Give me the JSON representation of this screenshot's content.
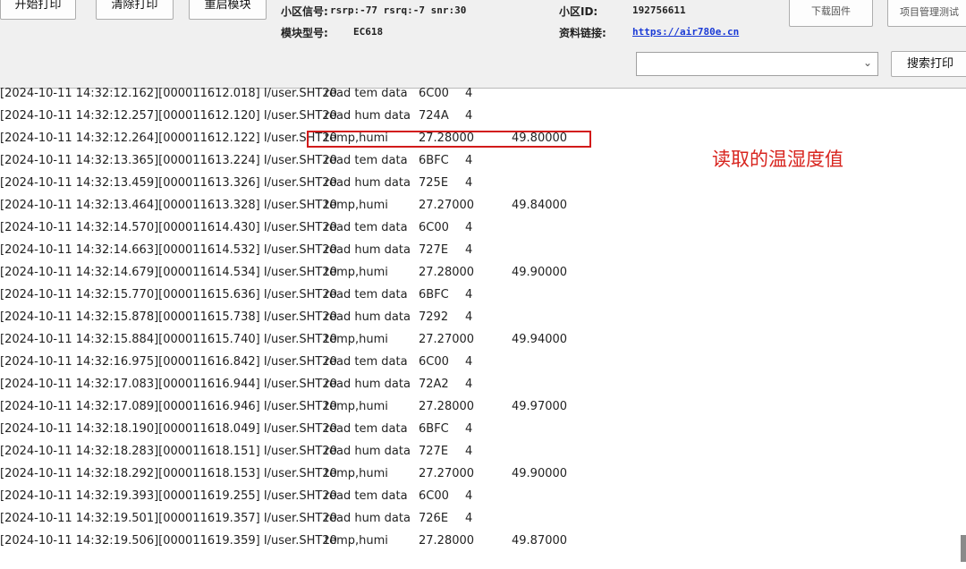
{
  "toolbar": {
    "btn_start_print": "开始打印",
    "btn_clear_print": "清除打印",
    "btn_restart_module": "重启模块",
    "cell_signal_label": "小区信号:",
    "cell_signal_value": "rsrp:-77 rsrq:-7 snr:30",
    "module_model_label": "模块型号:",
    "module_model_value": "EC618",
    "cell_id_label": "小区ID:",
    "cell_id_value": "192756611",
    "resource_link_label": "资料链接:",
    "resource_link_value": "https://air780e.cn",
    "btn_download_firmware": "下载固件",
    "btn_project_test": "项目管理测试",
    "search_combo_value": "",
    "btn_search_print": "搜索打印"
  },
  "annotation": "读取的温湿度值",
  "log_rows": [
    {
      "ts": "[2024-10-11 14:32:12.162][000011612.018] I/user.SHT20",
      "msg": "read tem data",
      "v1": "6C00",
      "v2": "4",
      "v3": ""
    },
    {
      "ts": "[2024-10-11 14:32:12.257][000011612.120] I/user.SHT20",
      "msg": "read hum data",
      "v1": "724A",
      "v2": "4",
      "v3": ""
    },
    {
      "ts": "[2024-10-11 14:32:12.264][000011612.122] I/user.SHT20",
      "msg": "temp,humi",
      "v1": "27.28000",
      "v2": "",
      "v3": "49.80000"
    },
    {
      "ts": "[2024-10-11 14:32:13.365][000011613.224] I/user.SHT20",
      "msg": "read tem data",
      "v1": "6BFC",
      "v2": "4",
      "v3": ""
    },
    {
      "ts": "[2024-10-11 14:32:13.459][000011613.326] I/user.SHT20",
      "msg": "read hum data",
      "v1": "725E",
      "v2": "4",
      "v3": ""
    },
    {
      "ts": "[2024-10-11 14:32:13.464][000011613.328] I/user.SHT20",
      "msg": "temp,humi",
      "v1": "27.27000",
      "v2": "",
      "v3": "49.84000"
    },
    {
      "ts": "[2024-10-11 14:32:14.570][000011614.430] I/user.SHT20",
      "msg": "read tem data",
      "v1": "6C00",
      "v2": "4",
      "v3": ""
    },
    {
      "ts": "[2024-10-11 14:32:14.663][000011614.532] I/user.SHT20",
      "msg": "read hum data",
      "v1": "727E",
      "v2": "4",
      "v3": ""
    },
    {
      "ts": "[2024-10-11 14:32:14.679][000011614.534] I/user.SHT20",
      "msg": "temp,humi",
      "v1": "27.28000",
      "v2": "",
      "v3": "49.90000"
    },
    {
      "ts": "[2024-10-11 14:32:15.770][000011615.636] I/user.SHT20",
      "msg": "read tem data",
      "v1": "6BFC",
      "v2": "4",
      "v3": ""
    },
    {
      "ts": "[2024-10-11 14:32:15.878][000011615.738] I/user.SHT20",
      "msg": "read hum data",
      "v1": "7292",
      "v2": "4",
      "v3": ""
    },
    {
      "ts": "[2024-10-11 14:32:15.884][000011615.740] I/user.SHT20",
      "msg": "temp,humi",
      "v1": "27.27000",
      "v2": "",
      "v3": "49.94000"
    },
    {
      "ts": "[2024-10-11 14:32:16.975][000011616.842] I/user.SHT20",
      "msg": "read tem data",
      "v1": "6C00",
      "v2": "4",
      "v3": ""
    },
    {
      "ts": "[2024-10-11 14:32:17.083][000011616.944] I/user.SHT20",
      "msg": "read hum data",
      "v1": "72A2",
      "v2": "4",
      "v3": ""
    },
    {
      "ts": "[2024-10-11 14:32:17.089][000011616.946] I/user.SHT20",
      "msg": "temp,humi",
      "v1": "27.28000",
      "v2": "",
      "v3": "49.97000"
    },
    {
      "ts": "[2024-10-11 14:32:18.190][000011618.049] I/user.SHT20",
      "msg": "read tem data",
      "v1": "6BFC",
      "v2": "4",
      "v3": ""
    },
    {
      "ts": "[2024-10-11 14:32:18.283][000011618.151] I/user.SHT20",
      "msg": "read hum data",
      "v1": "727E",
      "v2": "4",
      "v3": ""
    },
    {
      "ts": "[2024-10-11 14:32:18.292][000011618.153] I/user.SHT20",
      "msg": "temp,humi",
      "v1": "27.27000",
      "v2": "",
      "v3": "49.90000"
    },
    {
      "ts": "[2024-10-11 14:32:19.393][000011619.255] I/user.SHT20",
      "msg": "read tem data",
      "v1": "6C00",
      "v2": "4",
      "v3": ""
    },
    {
      "ts": "[2024-10-11 14:32:19.501][000011619.357] I/user.SHT20",
      "msg": "read hum data",
      "v1": "726E",
      "v2": "4",
      "v3": ""
    },
    {
      "ts": "[2024-10-11 14:32:19.506][000011619.359] I/user.SHT20",
      "msg": "temp,humi",
      "v1": "27.28000",
      "v2": "",
      "v3": "49.87000"
    }
  ],
  "colors": {
    "highlight_border": "#d21a1a",
    "annotation_text": "#d8241e",
    "link": "#1a3ad6"
  }
}
